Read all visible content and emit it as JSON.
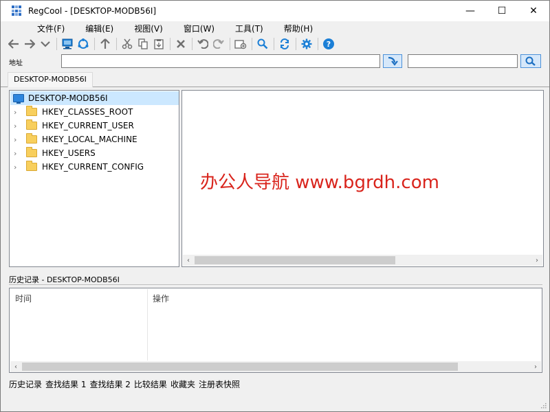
{
  "window": {
    "title": "RegCool - [DESKTOP-MODB56I]",
    "controls": [
      "—",
      "☐",
      "✕"
    ]
  },
  "menu": [
    "文件(F)",
    "编辑(E)",
    "视图(V)",
    "窗口(W)",
    "工具(T)",
    "帮助(H)"
  ],
  "address": {
    "label": "地址",
    "value": "",
    "search_value": ""
  },
  "tab": "DESKTOP-MODB56I",
  "tree": {
    "root": "DESKTOP-MODB56I",
    "hives": [
      "HKEY_CLASSES_ROOT",
      "HKEY_CURRENT_USER",
      "HKEY_LOCAL_MACHINE",
      "HKEY_USERS",
      "HKEY_CURRENT_CONFIG"
    ]
  },
  "watermark": "办公人导航 www.bgrdh.com",
  "history": {
    "title": "历史记录 - DESKTOP-MODB56I",
    "col_time": "时间",
    "col_action": "操作"
  },
  "bottom_tabs": [
    "历史记录",
    "查找结果 1",
    "查找结果 2",
    "比较结果",
    "收藏夹",
    "注册表快照"
  ],
  "colors": {
    "selection": "#cce8ff",
    "accent": "#1b7fd6",
    "watermark": "#d9241c"
  }
}
